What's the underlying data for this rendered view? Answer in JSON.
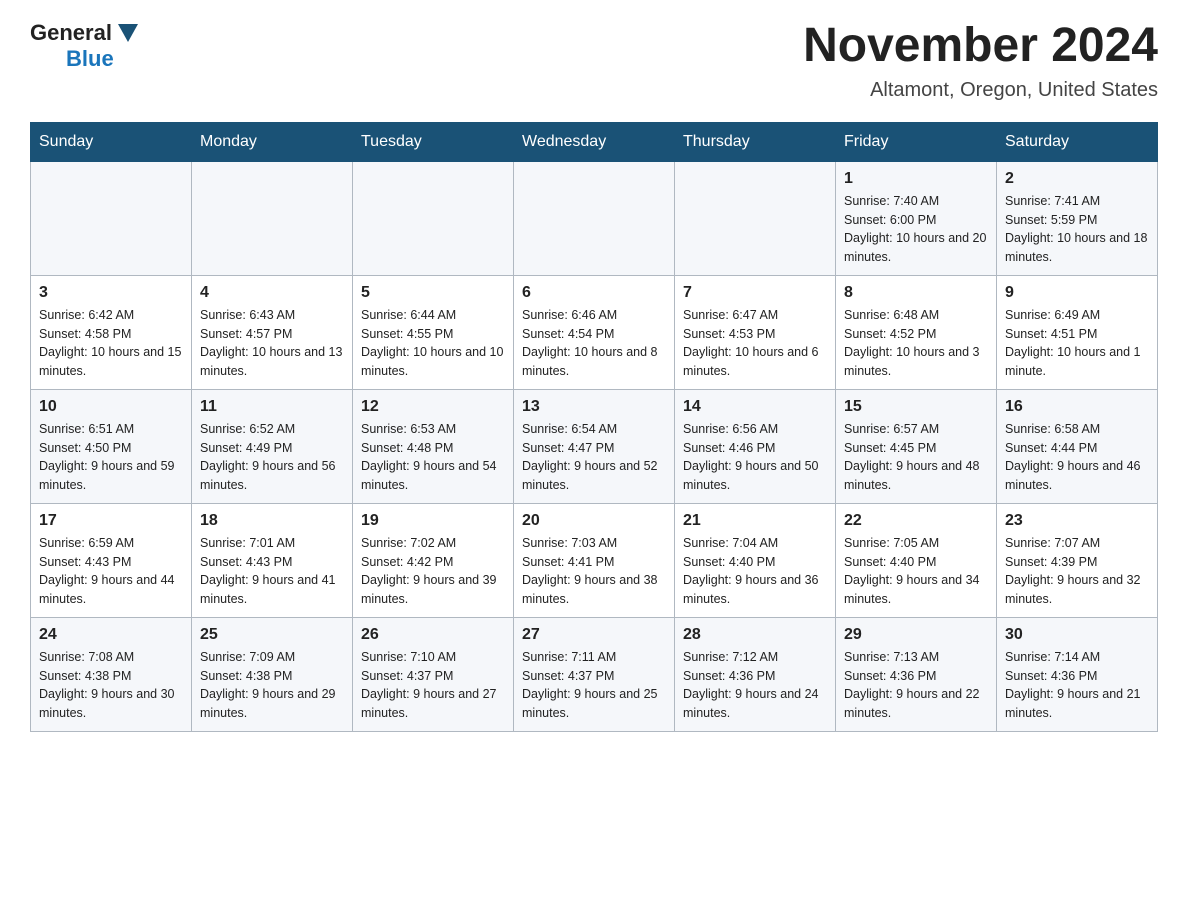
{
  "header": {
    "logo_general": "General",
    "logo_blue": "Blue",
    "month_title": "November 2024",
    "location": "Altamont, Oregon, United States"
  },
  "days_of_week": [
    "Sunday",
    "Monday",
    "Tuesday",
    "Wednesday",
    "Thursday",
    "Friday",
    "Saturday"
  ],
  "weeks": [
    [
      {
        "day": "",
        "sunrise": "",
        "sunset": "",
        "daylight": ""
      },
      {
        "day": "",
        "sunrise": "",
        "sunset": "",
        "daylight": ""
      },
      {
        "day": "",
        "sunrise": "",
        "sunset": "",
        "daylight": ""
      },
      {
        "day": "",
        "sunrise": "",
        "sunset": "",
        "daylight": ""
      },
      {
        "day": "",
        "sunrise": "",
        "sunset": "",
        "daylight": ""
      },
      {
        "day": "1",
        "sunrise": "Sunrise: 7:40 AM",
        "sunset": "Sunset: 6:00 PM",
        "daylight": "Daylight: 10 hours and 20 minutes."
      },
      {
        "day": "2",
        "sunrise": "Sunrise: 7:41 AM",
        "sunset": "Sunset: 5:59 PM",
        "daylight": "Daylight: 10 hours and 18 minutes."
      }
    ],
    [
      {
        "day": "3",
        "sunrise": "Sunrise: 6:42 AM",
        "sunset": "Sunset: 4:58 PM",
        "daylight": "Daylight: 10 hours and 15 minutes."
      },
      {
        "day": "4",
        "sunrise": "Sunrise: 6:43 AM",
        "sunset": "Sunset: 4:57 PM",
        "daylight": "Daylight: 10 hours and 13 minutes."
      },
      {
        "day": "5",
        "sunrise": "Sunrise: 6:44 AM",
        "sunset": "Sunset: 4:55 PM",
        "daylight": "Daylight: 10 hours and 10 minutes."
      },
      {
        "day": "6",
        "sunrise": "Sunrise: 6:46 AM",
        "sunset": "Sunset: 4:54 PM",
        "daylight": "Daylight: 10 hours and 8 minutes."
      },
      {
        "day": "7",
        "sunrise": "Sunrise: 6:47 AM",
        "sunset": "Sunset: 4:53 PM",
        "daylight": "Daylight: 10 hours and 6 minutes."
      },
      {
        "day": "8",
        "sunrise": "Sunrise: 6:48 AM",
        "sunset": "Sunset: 4:52 PM",
        "daylight": "Daylight: 10 hours and 3 minutes."
      },
      {
        "day": "9",
        "sunrise": "Sunrise: 6:49 AM",
        "sunset": "Sunset: 4:51 PM",
        "daylight": "Daylight: 10 hours and 1 minute."
      }
    ],
    [
      {
        "day": "10",
        "sunrise": "Sunrise: 6:51 AM",
        "sunset": "Sunset: 4:50 PM",
        "daylight": "Daylight: 9 hours and 59 minutes."
      },
      {
        "day": "11",
        "sunrise": "Sunrise: 6:52 AM",
        "sunset": "Sunset: 4:49 PM",
        "daylight": "Daylight: 9 hours and 56 minutes."
      },
      {
        "day": "12",
        "sunrise": "Sunrise: 6:53 AM",
        "sunset": "Sunset: 4:48 PM",
        "daylight": "Daylight: 9 hours and 54 minutes."
      },
      {
        "day": "13",
        "sunrise": "Sunrise: 6:54 AM",
        "sunset": "Sunset: 4:47 PM",
        "daylight": "Daylight: 9 hours and 52 minutes."
      },
      {
        "day": "14",
        "sunrise": "Sunrise: 6:56 AM",
        "sunset": "Sunset: 4:46 PM",
        "daylight": "Daylight: 9 hours and 50 minutes."
      },
      {
        "day": "15",
        "sunrise": "Sunrise: 6:57 AM",
        "sunset": "Sunset: 4:45 PM",
        "daylight": "Daylight: 9 hours and 48 minutes."
      },
      {
        "day": "16",
        "sunrise": "Sunrise: 6:58 AM",
        "sunset": "Sunset: 4:44 PM",
        "daylight": "Daylight: 9 hours and 46 minutes."
      }
    ],
    [
      {
        "day": "17",
        "sunrise": "Sunrise: 6:59 AM",
        "sunset": "Sunset: 4:43 PM",
        "daylight": "Daylight: 9 hours and 44 minutes."
      },
      {
        "day": "18",
        "sunrise": "Sunrise: 7:01 AM",
        "sunset": "Sunset: 4:43 PM",
        "daylight": "Daylight: 9 hours and 41 minutes."
      },
      {
        "day": "19",
        "sunrise": "Sunrise: 7:02 AM",
        "sunset": "Sunset: 4:42 PM",
        "daylight": "Daylight: 9 hours and 39 minutes."
      },
      {
        "day": "20",
        "sunrise": "Sunrise: 7:03 AM",
        "sunset": "Sunset: 4:41 PM",
        "daylight": "Daylight: 9 hours and 38 minutes."
      },
      {
        "day": "21",
        "sunrise": "Sunrise: 7:04 AM",
        "sunset": "Sunset: 4:40 PM",
        "daylight": "Daylight: 9 hours and 36 minutes."
      },
      {
        "day": "22",
        "sunrise": "Sunrise: 7:05 AM",
        "sunset": "Sunset: 4:40 PM",
        "daylight": "Daylight: 9 hours and 34 minutes."
      },
      {
        "day": "23",
        "sunrise": "Sunrise: 7:07 AM",
        "sunset": "Sunset: 4:39 PM",
        "daylight": "Daylight: 9 hours and 32 minutes."
      }
    ],
    [
      {
        "day": "24",
        "sunrise": "Sunrise: 7:08 AM",
        "sunset": "Sunset: 4:38 PM",
        "daylight": "Daylight: 9 hours and 30 minutes."
      },
      {
        "day": "25",
        "sunrise": "Sunrise: 7:09 AM",
        "sunset": "Sunset: 4:38 PM",
        "daylight": "Daylight: 9 hours and 29 minutes."
      },
      {
        "day": "26",
        "sunrise": "Sunrise: 7:10 AM",
        "sunset": "Sunset: 4:37 PM",
        "daylight": "Daylight: 9 hours and 27 minutes."
      },
      {
        "day": "27",
        "sunrise": "Sunrise: 7:11 AM",
        "sunset": "Sunset: 4:37 PM",
        "daylight": "Daylight: 9 hours and 25 minutes."
      },
      {
        "day": "28",
        "sunrise": "Sunrise: 7:12 AM",
        "sunset": "Sunset: 4:36 PM",
        "daylight": "Daylight: 9 hours and 24 minutes."
      },
      {
        "day": "29",
        "sunrise": "Sunrise: 7:13 AM",
        "sunset": "Sunset: 4:36 PM",
        "daylight": "Daylight: 9 hours and 22 minutes."
      },
      {
        "day": "30",
        "sunrise": "Sunrise: 7:14 AM",
        "sunset": "Sunset: 4:36 PM",
        "daylight": "Daylight: 9 hours and 21 minutes."
      }
    ]
  ]
}
